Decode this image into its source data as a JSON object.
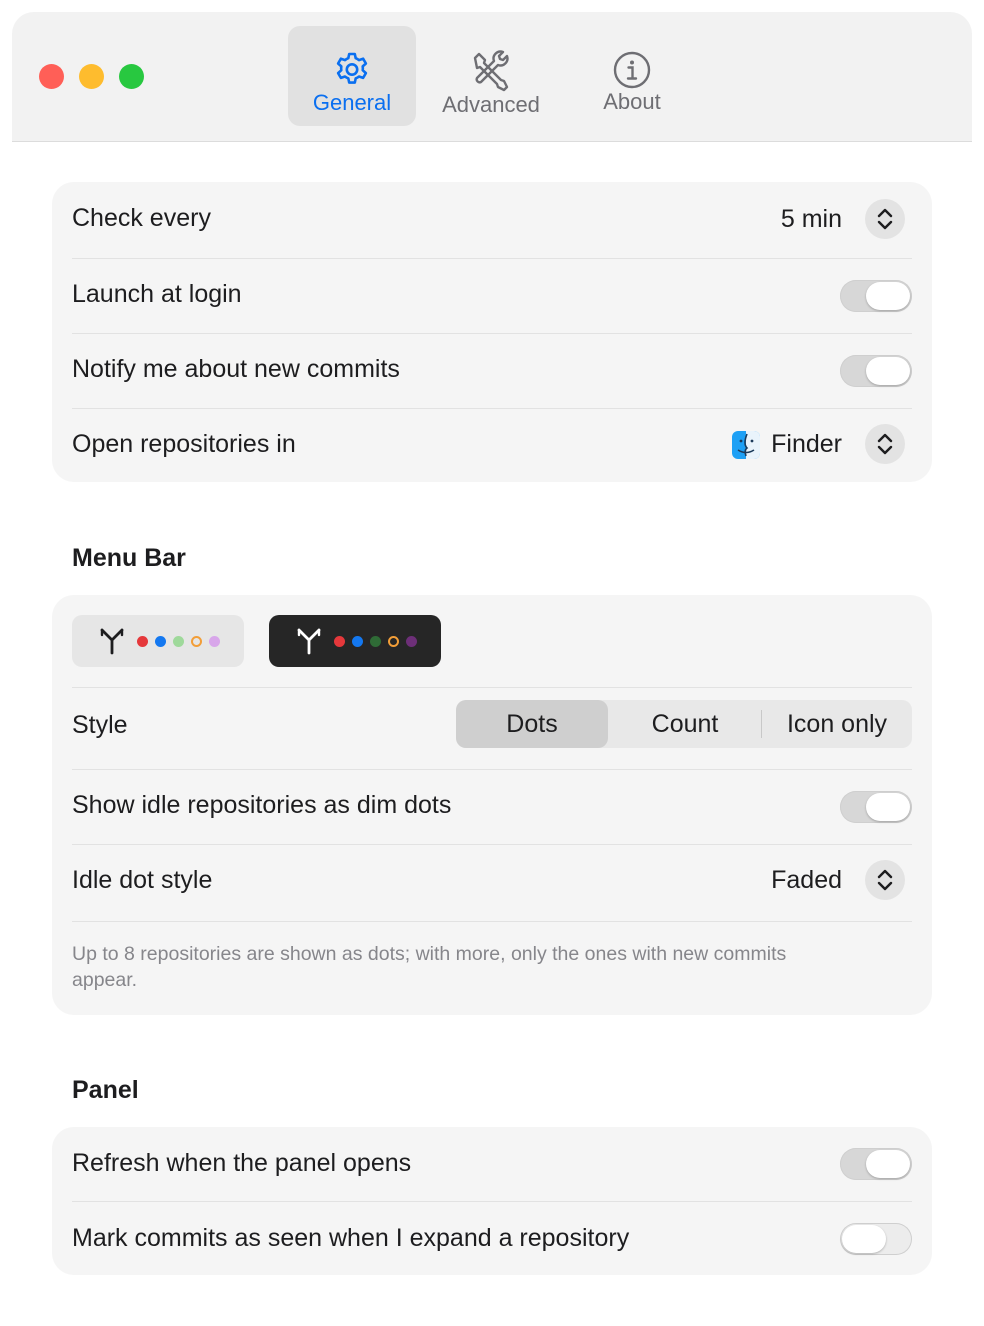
{
  "tabs": [
    {
      "label": "General",
      "active": true,
      "icon": "gear-icon"
    },
    {
      "label": "Advanced",
      "active": false,
      "icon": "wrench-screwdriver-icon"
    },
    {
      "label": "About",
      "active": false,
      "icon": "info-circle-icon"
    }
  ],
  "general": {
    "check_every": {
      "label": "Check every",
      "value": "5 min"
    },
    "launch_at_login": {
      "label": "Launch at login",
      "enabled": true
    },
    "notify_commits": {
      "label": "Notify me about new commits",
      "enabled": true
    },
    "open_in": {
      "label": "Open repositories in",
      "value": "Finder",
      "icon": "finder-icon"
    }
  },
  "menu_bar": {
    "title": "Menu Bar",
    "previews": {
      "light_dots": [
        "#e5383b",
        "#1478f0",
        "#9fd99b",
        "#f29e38",
        "#d8a6ea"
      ],
      "dark_dots": [
        "#e5383b",
        "#1478f0",
        "#2f6b36",
        "#f29e38",
        "#6d2f78"
      ]
    },
    "style": {
      "label": "Style",
      "options": [
        "Dots",
        "Count",
        "Icon only"
      ],
      "selected": "Dots"
    },
    "show_idle": {
      "label": "Show idle repositories as dim dots",
      "enabled": true
    },
    "idle_dot_style": {
      "label": "Idle dot style",
      "value": "Faded"
    },
    "footnote": "Up to 8 repositories are shown as dots; with more, only the ones with new commits appear."
  },
  "panel": {
    "title": "Panel",
    "refresh_on_open": {
      "label": "Refresh when the panel opens",
      "enabled": true
    },
    "mark_seen": {
      "label": "Mark commits as seen when I expand a repository",
      "enabled": false
    }
  },
  "colors": {
    "accent": "#0a6ff0",
    "window_bg": "#ffffff",
    "card_bg": "#f5f5f5"
  }
}
